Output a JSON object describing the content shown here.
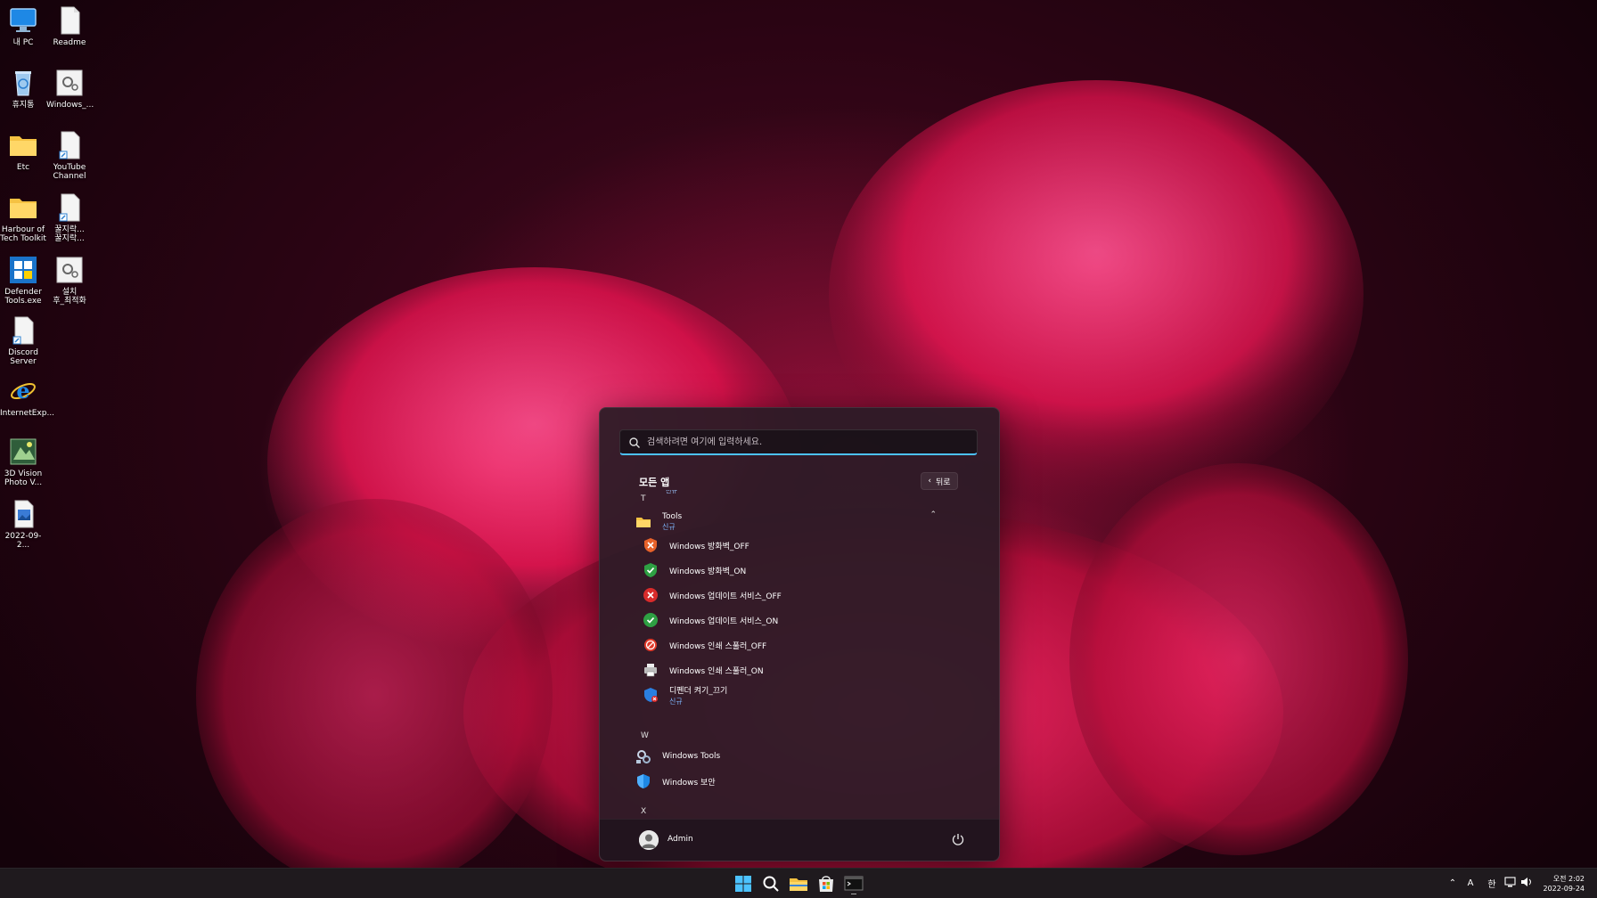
{
  "desktop": {
    "icons": [
      {
        "label": "내 PC",
        "icon": "monitor-icon"
      },
      {
        "label": "Readme",
        "icon": "document-icon"
      },
      {
        "label": "휴지통",
        "icon": "recycle-bin-icon"
      },
      {
        "label": "Windows_...",
        "icon": "settings-file-icon"
      },
      {
        "label": "Etc",
        "icon": "folder-icon"
      },
      {
        "label": "YouTube\nChannel",
        "icon": "shortcut-icon"
      },
      {
        "label": "Harbour of\nTech Toolkit",
        "icon": "folder-icon"
      },
      {
        "label": "꿀지락...\n꿀지락...",
        "icon": "shortcut-icon"
      },
      {
        "label": "Defender\nTools.exe",
        "icon": "windows-logo-icon"
      },
      {
        "label": "설치\n후_최적화",
        "icon": "settings-file-icon"
      },
      {
        "label": "Discord\nServer",
        "icon": "shortcut-icon"
      },
      {
        "label": "InternetExp...",
        "icon": "internet-explorer-icon"
      },
      {
        "label": "3D Vision\nPhoto V...",
        "icon": "photo-viewer-icon"
      },
      {
        "label": "2022-09-2...",
        "icon": "image-file-icon"
      }
    ]
  },
  "start_menu": {
    "search_placeholder": "검색하려면 여기에 입력하세요.",
    "all_apps_title": "모든 앱",
    "back_label": "뒤로",
    "cut_text": "신규",
    "section_t": "T",
    "tools_folder": {
      "label": "Tools",
      "badge": "신규"
    },
    "tool_items": [
      {
        "label": "Windows 방화벽_OFF",
        "icon": "shield-x-icon",
        "color": "#e8622a"
      },
      {
        "label": "Windows 방화벽_ON",
        "icon": "shield-check-icon",
        "color": "#2ea043"
      },
      {
        "label": "Windows 업데이트 서비스_OFF",
        "icon": "red-x-circle-icon",
        "color": "#d92b2b"
      },
      {
        "label": "Windows 업데이트 서비스_ON",
        "icon": "green-check-circle-icon",
        "color": "#2ea043"
      },
      {
        "label": "Windows 인쇄 스풀러_OFF",
        "icon": "no-sign-icon",
        "color": "#e03a2a"
      },
      {
        "label": "Windows 인쇄 스풀러_ON",
        "icon": "printer-icon",
        "color": "#dddddd"
      }
    ],
    "defender_item": {
      "label": "디펜더 켜기_끄기",
      "badge": "신규"
    },
    "section_w": "W",
    "w_items": [
      {
        "label": "Windows Tools",
        "icon": "windows-tools-icon"
      },
      {
        "label": "Windows 보안",
        "icon": "windows-security-icon"
      }
    ],
    "section_x": "X",
    "user_name": "Admin"
  },
  "taskbar": {
    "tray_ime_a": "A",
    "tray_ime_han": "한",
    "clock_time": "오전 2:02",
    "clock_date": "2022-09-24"
  },
  "colors": {
    "accent": "#4cc2ff",
    "new_badge": "#7fb8ff",
    "menu_bg": "#2c1c26",
    "taskbar_bg": "#1f1a1e"
  }
}
